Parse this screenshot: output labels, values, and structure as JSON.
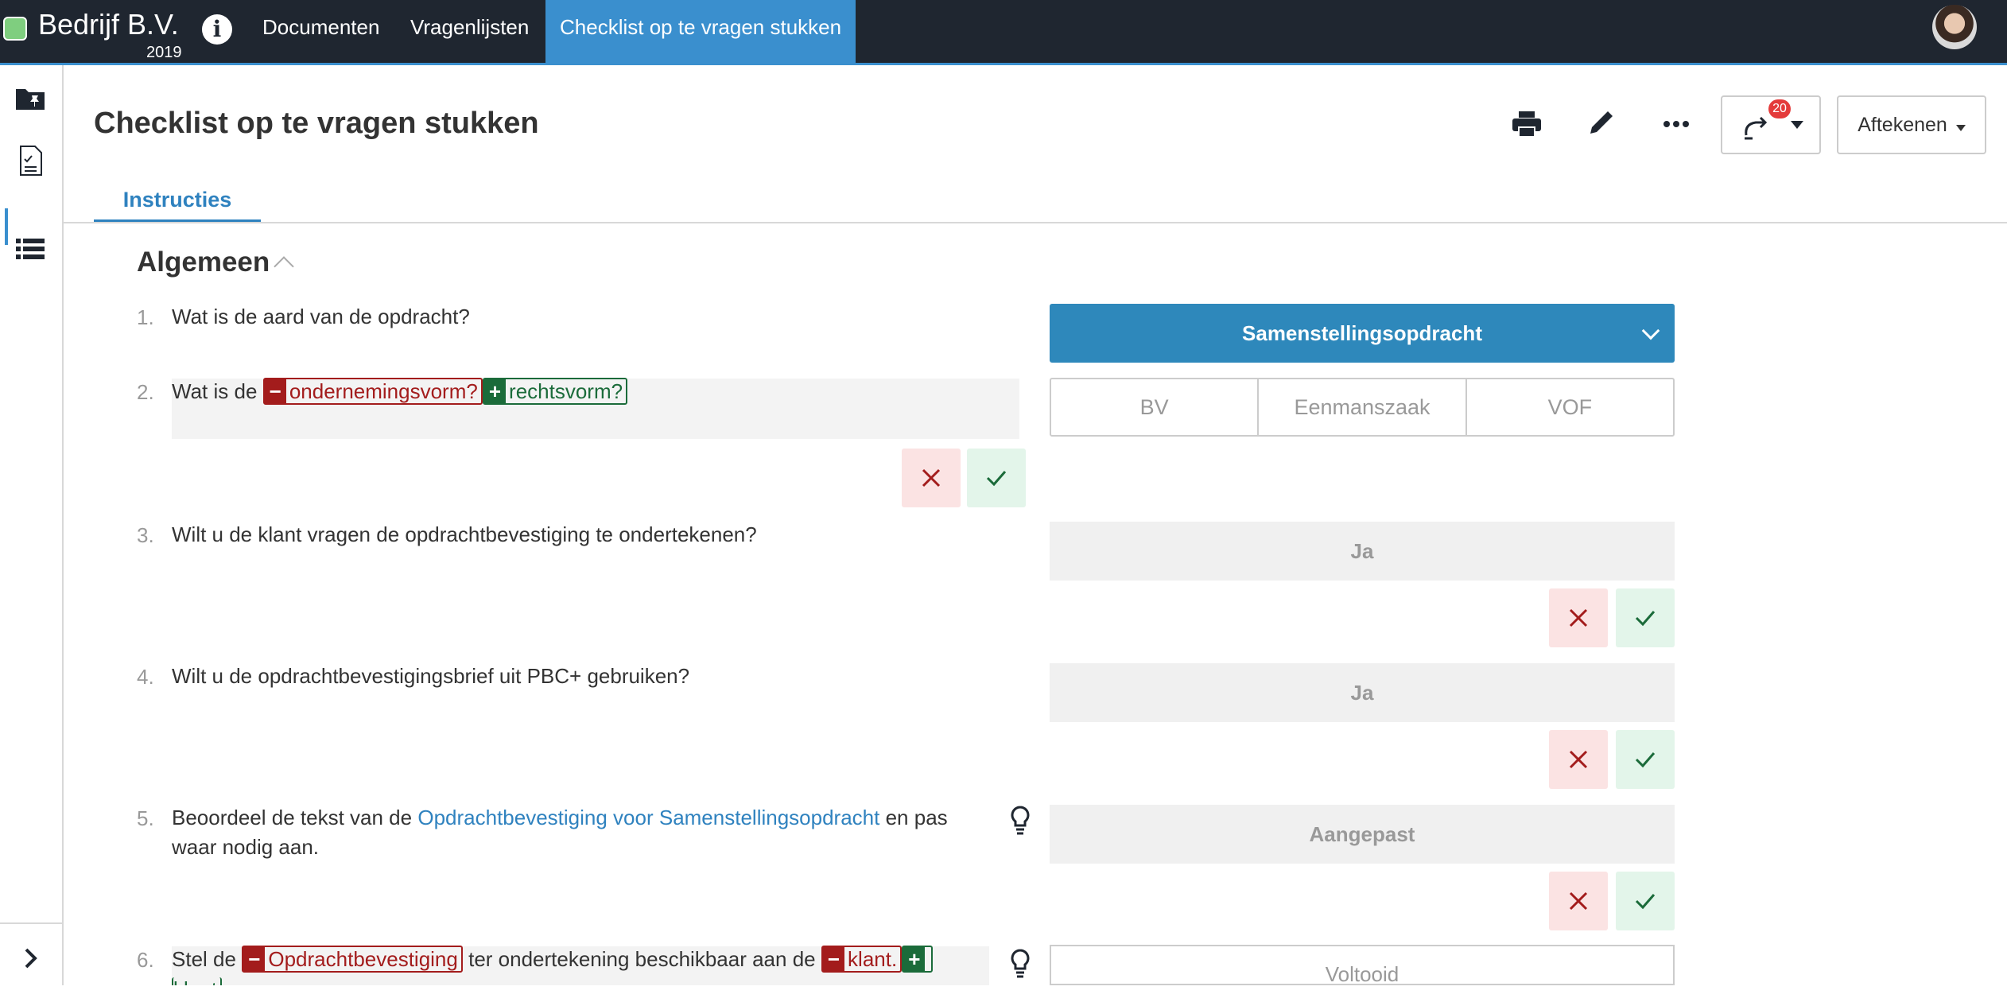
{
  "app": {
    "company": "Bedrijf B.V.",
    "year": "2019",
    "nav": [
      "Documenten",
      "Vragenlijsten",
      "Checklist op te vragen stukken"
    ]
  },
  "page": {
    "title": "Checklist op te vragen stukken",
    "badge_count": "20",
    "aftekenen_label": "Aftekenen",
    "tab_label": "Instructies"
  },
  "section": {
    "title": "Algemeen"
  },
  "questions": [
    {
      "num": "1.",
      "text": "Wat is de aard van de opdracht?",
      "answer": "Samenstellingsopdracht"
    },
    {
      "num": "2.",
      "prefix": "Wat is de",
      "deleted": "ondernemingsvorm?",
      "inserted": "rechtsvorm?",
      "options": [
        "BV",
        "Eenmanszaak",
        "VOF"
      ]
    },
    {
      "num": "3.",
      "text": "Wilt u de klant vragen de opdrachtbevestiging te ondertekenen?",
      "answer": "Ja"
    },
    {
      "num": "4.",
      "text": "Wilt u de opdrachtbevestigingsbrief uit PBC+  gebruiken?",
      "answer": "Ja"
    },
    {
      "num": "5.",
      "text_before": "Beoordeel de tekst van de",
      "link": "Opdrachtbevestiging voor Samenstellingsopdracht",
      "text_after": "en pas",
      "text_line2": "waar nodig aan.",
      "answer": "Aangepast"
    },
    {
      "num": "6.",
      "prefix": "Stel de",
      "deleted1": "Opdrachtbevestiging",
      "middle": "ter ondertekening beschikbaar aan de",
      "deleted2": "klant.",
      "inserted_partial": "klant",
      "answer": "Voltooid"
    }
  ],
  "colors": {
    "topbar": "#1f2630",
    "accent": "#3a8fce",
    "primary_select": "#2e88bb",
    "deleted": "#a31c1c",
    "inserted": "#1b6b3a"
  },
  "icons": [
    "info-icon",
    "pin-folder-icon",
    "checklist-document-icon",
    "list-icon",
    "chevron-right-icon",
    "print-icon",
    "pencil-icon",
    "more-icon",
    "sync-icon",
    "caret-down-icon",
    "close-icon",
    "check-icon",
    "lightbulb-icon",
    "chevron-up-icon"
  ]
}
